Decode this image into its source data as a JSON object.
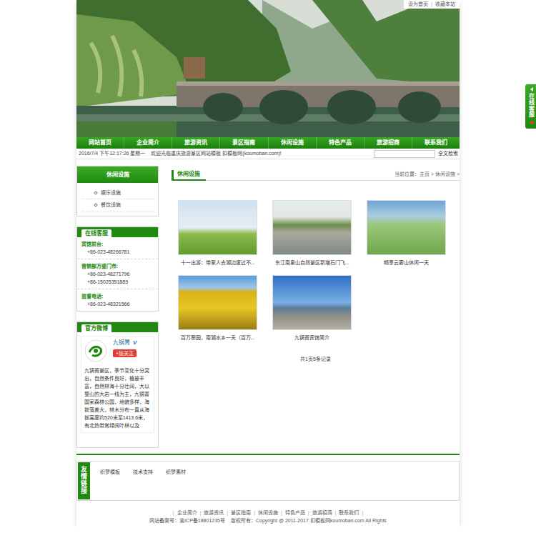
{
  "header": {
    "top_links": [
      "设为首页",
      "收藏本站"
    ],
    "separator": "|"
  },
  "nav": [
    "网站首页",
    "企业简介",
    "旅游资讯",
    "景区指南",
    "休闲设施",
    "特色产品",
    "旅游招商",
    "联系我们"
  ],
  "ticker": {
    "datetime": "2016/7/4 下午12:17:26 星期一",
    "message": "欢迎光临重庆旅游景区网站模板 扣模板网(koumoban.com)!"
  },
  "search": {
    "button": "全文检索"
  },
  "sidebar": {
    "category": {
      "title": "休闲设施",
      "items": [
        "娱乐设施",
        "餐饮设施"
      ]
    },
    "service": {
      "title": "在线客服",
      "groups": [
        {
          "label": "宾馆前台:",
          "phones": [
            "+86-023-48266781"
          ]
        },
        {
          "label": "营销部万盛门市:",
          "phones": [
            "+86-023-48271796",
            "+86-15025351889"
          ]
        },
        {
          "label": "监督电话:",
          "phones": [
            "+86-023-48321566"
          ]
        }
      ]
    },
    "weibo": {
      "title": "官方微博",
      "name": "九锅箐",
      "badge": "V",
      "follow": "+加关注",
      "text": "九锅箐景区，季节变化十分突出，自然条件良好，植被丰富，自然林海十分壮阔，大以整山的大岩一线为主，九锅箐国家森林公园，地貌多样，海拔落差大，林木分布一直从海拔高度约520米至1413.6米，有北热带常绿阔叶林以及"
    }
  },
  "main": {
    "title": "休闲设施",
    "breadcrumb": "当前位置：主页 > 休闲设施 >",
    "items": [
      {
        "caption": "十一出游：带家人去湖边度过不..."
      },
      {
        "caption": "东江南泉山自然景区新增石门飞..."
      },
      {
        "caption": "畅享云雾山休闲一天"
      },
      {
        "caption": "百万葵园，南湖水乡一天（百万..."
      },
      {
        "caption": "九锅箐宾馆简介"
      }
    ],
    "pager": "共1页5条记录"
  },
  "links": {
    "title": "友情链接",
    "items": [
      "织梦模板",
      "技术支持",
      "织梦素材"
    ]
  },
  "footer": {
    "links": [
      "企业简介",
      "旅游资讯",
      "景区指南",
      "休闲设施",
      "特色产品",
      "旅游招商",
      "联系我们"
    ],
    "separator": "|",
    "record": "网站备案号：渝ICP备18801235号",
    "copyright": "版权所有：Copyright @ 2011-2017 扣模板网koumoban.com All Rights"
  },
  "float_service": {
    "label": "在线客服"
  }
}
